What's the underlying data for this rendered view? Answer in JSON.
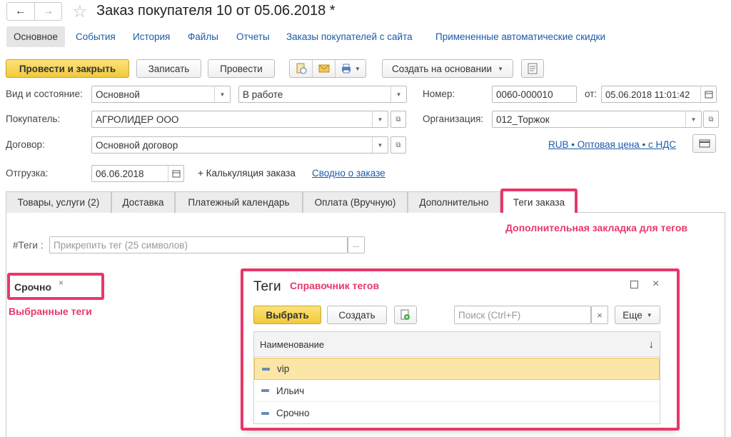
{
  "window": {
    "title": "Заказ покупателя 10 от 05.06.2018 *",
    "back_glyph": "←",
    "forward_glyph": "→"
  },
  "top_tabs": [
    {
      "label": "Основное"
    },
    {
      "label": "События"
    },
    {
      "label": "История"
    },
    {
      "label": "Файлы"
    },
    {
      "label": "Отчеты"
    },
    {
      "label": "Заказы покупателей с сайта"
    },
    {
      "label": "Примененные автоматические скидки"
    }
  ],
  "toolbar": {
    "post_close": "Провести и закрыть",
    "save": "Записать",
    "post": "Провести",
    "create_based": "Создать на основании"
  },
  "form": {
    "kind_label": "Вид и состояние:",
    "kind_value": "Основной",
    "state_value": "В работе",
    "number_label": "Номер:",
    "number_value": "0060-000010",
    "from_label": "от:",
    "date_value": "05.06.2018 11:01:42",
    "buyer_label": "Покупатель:",
    "buyer_value": "АГРОЛИДЕР ООО",
    "org_label": "Организация:",
    "org_value": "012_Торжок",
    "contract_label": "Договор:",
    "contract_value": "Основной договор",
    "price_link": "RUB • Оптовая цена • с НДС",
    "shipment_label": "Отгрузка:",
    "shipment_value": "06.06.2018",
    "calc_label": "+ Калькуляция заказа",
    "summary_link": "Сводно о заказе"
  },
  "tabs": [
    {
      "label": "Товары, услуги (2)"
    },
    {
      "label": "Доставка"
    },
    {
      "label": "Платежный календарь"
    },
    {
      "label": "Оплата (Вручную)"
    },
    {
      "label": "Дополнительно"
    },
    {
      "label": "Теги заказа"
    }
  ],
  "tags_tab": {
    "tags_label": "#Теги :",
    "tags_placeholder": "Прикрепить тег (25 символов)",
    "more_glyph": "...",
    "selected_tag": "Срочно",
    "remove_glyph": "×"
  },
  "annotations": {
    "tab_note": "Дополнительная закладка для тегов",
    "selected_note": "Выбранные теги",
    "dialog_note": "Справочник тегов"
  },
  "dialog": {
    "title": "Теги",
    "select_button": "Выбрать",
    "create_button": "Создать",
    "search_placeholder": "Поиск (Ctrl+F)",
    "clear_glyph": "×",
    "more_button": "Еще",
    "column_header": "Наименование",
    "sort_glyph": "↓",
    "rows": [
      {
        "name": "vip",
        "selected": true
      },
      {
        "name": "Ильич",
        "selected": false
      },
      {
        "name": "Срочно",
        "selected": false
      }
    ]
  },
  "colors": {
    "accent_yellow": "#f2c93a",
    "annotation_red": "#e8386a",
    "link_blue": "#1d5aa8"
  }
}
